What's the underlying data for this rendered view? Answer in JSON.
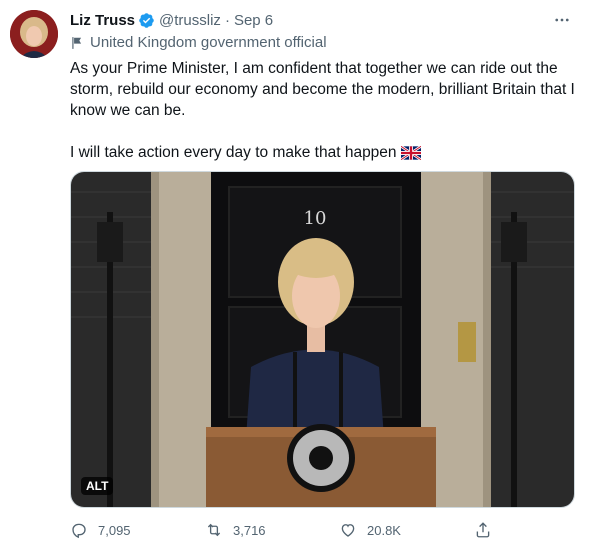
{
  "tweet": {
    "author_name": "Liz Truss",
    "handle": "@trussliz",
    "separator": "·",
    "date": "Sep 6",
    "label": "United Kingdom government official",
    "text_paragraph_1": "As your Prime Minister, I am confident that together we can ride out the storm, rebuild our economy and become the modern, brilliant Britain that I know we can be.",
    "text_paragraph_2": "I will take action every day to make that happen",
    "media": {
      "alt_badge": "ALT",
      "door_number": "10"
    },
    "actions": {
      "replies": "7,095",
      "retweets": "3,716",
      "likes": "20.8K"
    }
  },
  "icons": {
    "verified": "verified-badge-icon",
    "more": "more-horizontal-icon",
    "label": "flag-label-icon",
    "reply": "reply-icon",
    "retweet": "retweet-icon",
    "like": "heart-icon",
    "share": "share-icon"
  },
  "colors": {
    "verified_blue": "#1d9bf0",
    "text": "#0f1419",
    "secondary": "#536471"
  }
}
